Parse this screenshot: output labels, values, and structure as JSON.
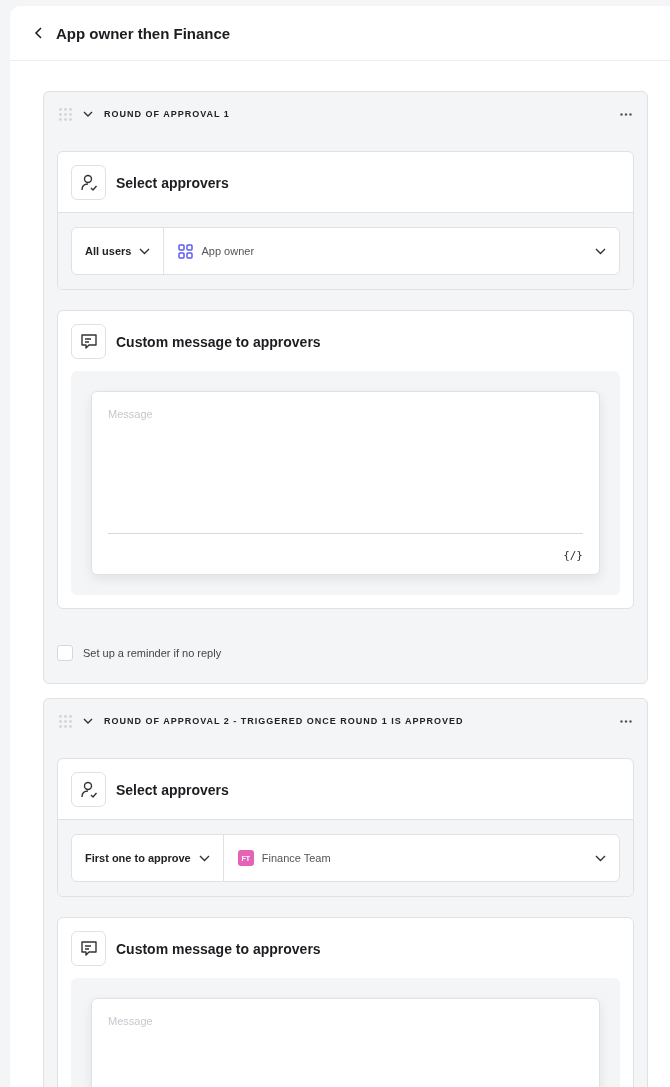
{
  "header": {
    "title": "App owner then Finance"
  },
  "rounds": [
    {
      "title": "ROUND OF APPROVAL 1",
      "approvers": {
        "heading": "Select approvers",
        "mode": "All users",
        "value": {
          "kind": "app",
          "label": "App owner"
        }
      },
      "message": {
        "heading": "Custom message to approvers",
        "placeholder": "Message",
        "variable_button": "{/}"
      },
      "reminder": {
        "label": "Set up a reminder if no reply",
        "checked": false
      }
    },
    {
      "title": "ROUND OF APPROVAL 2 - TRIGGERED ONCE ROUND 1 IS APPROVED",
      "approvers": {
        "heading": "Select approvers",
        "mode": "First one to approve",
        "value": {
          "kind": "team",
          "label": "Finance Team",
          "initials": "FT",
          "color": "#e562b9"
        }
      },
      "message": {
        "heading": "Custom message to approvers",
        "placeholder": "Message"
      }
    }
  ]
}
